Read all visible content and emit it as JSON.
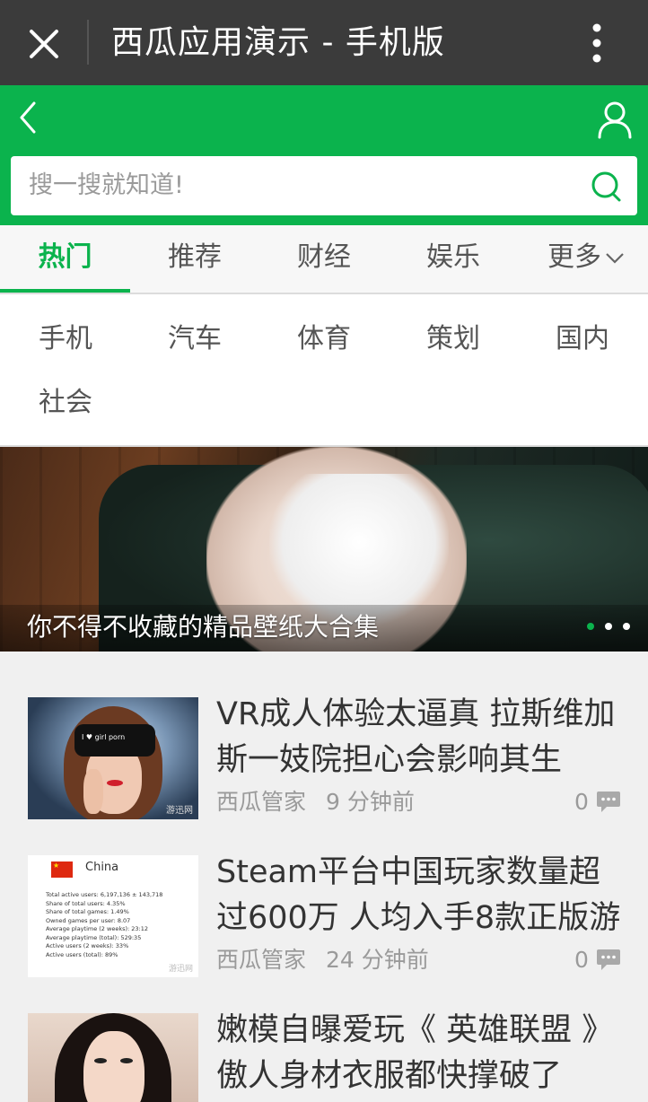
{
  "titlebar": {
    "title": "西瓜应用演示 - 手机版",
    "bg_color": "#3b3b3b"
  },
  "header": {
    "accent_color": "#0bb34d",
    "search_placeholder": "搜一搜就知道!"
  },
  "tabs": [
    {
      "label": "热门",
      "active": true
    },
    {
      "label": "推荐",
      "active": false
    },
    {
      "label": "财经",
      "active": false
    },
    {
      "label": "娱乐",
      "active": false
    },
    {
      "label": "更多",
      "active": false
    }
  ],
  "categories": [
    "手机",
    "汽车",
    "体育",
    "策划",
    "国内",
    "社会"
  ],
  "banner": {
    "caption": "你不得不收藏的精品壁纸大合集",
    "slide_count": 3,
    "active_slide": 1
  },
  "news": [
    {
      "title": "VR成人体验太逼真 拉斯维加斯一妓院担心会影响其生",
      "source": "西瓜管家",
      "time": "9 分钟前",
      "comments": "0",
      "thumb_text": {
        "vr": "I ♥ girl porn",
        "watermark": "游迅网"
      }
    },
    {
      "title": "Steam平台中国玩家数量超过600万 人均入手8款正版游",
      "source": "西瓜管家",
      "time": "24 分钟前",
      "comments": "0",
      "thumb_text": {
        "country": "China",
        "stats": [
          "Total active users: 6,197,136 ± 143,718",
          "Share of total users: 4.35%",
          "Share of total games: 1.49%",
          "Owned games per user: 8.07",
          "Average playtime (2 weeks): 23:12",
          "Average playtime (total): 529:35",
          "Active users (2 weeks): 33%",
          "Active users (total): 89%"
        ],
        "watermark": "游迅网"
      }
    },
    {
      "title": "嫩模自曝爱玩《 英雄联盟 》傲人身材衣服都快撑破了",
      "source": "",
      "time": "",
      "comments": ""
    }
  ]
}
